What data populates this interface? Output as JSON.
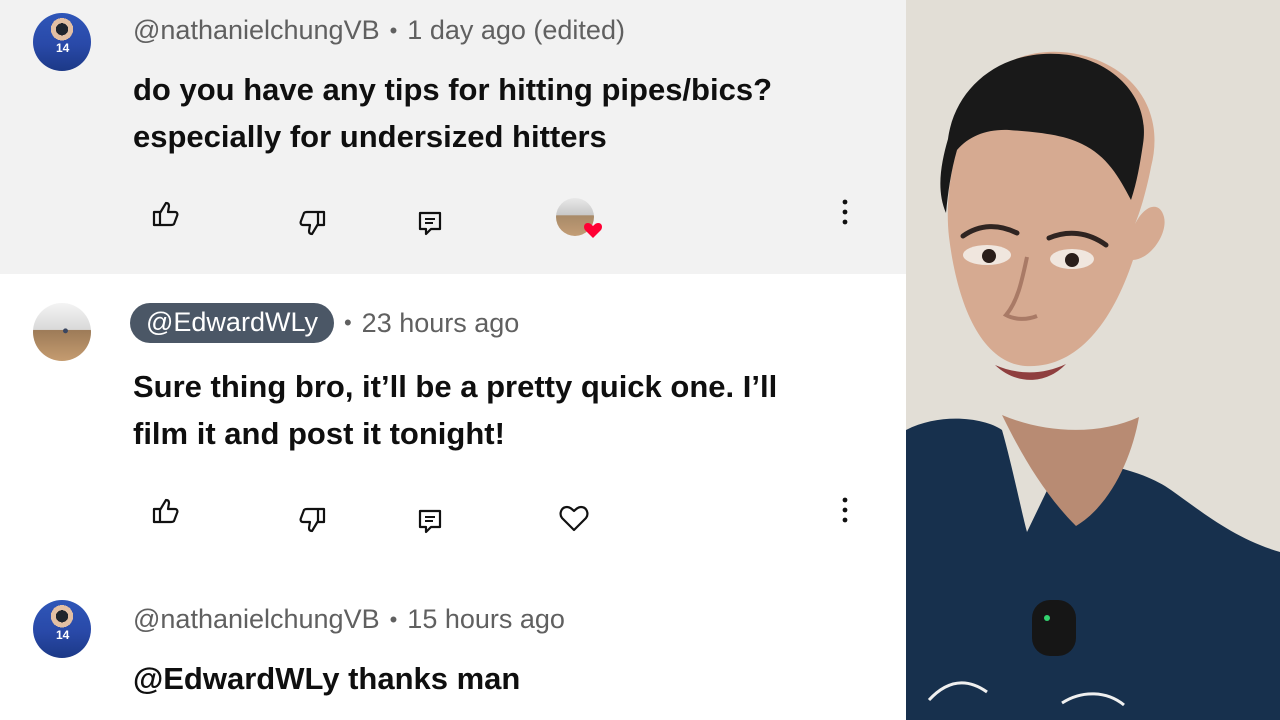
{
  "comments": [
    {
      "handle": "@nathanielchungVB",
      "separator": "•",
      "timestamp": "1 day ago (edited)",
      "text_lines": [
        "do you have any tips for hitting pipes/bics?",
        "especially for undersized hitters"
      ],
      "highlighted": true,
      "liked_by_creator": true
    },
    {
      "handle": "@EdwardWLy",
      "separator": "•",
      "timestamp": "23 hours ago",
      "text_lines": [
        "Sure thing bro, it’ll be a pretty quick one. I’ll",
        "film it and post it tonight!"
      ],
      "highlighted": false,
      "creator_badge": true
    },
    {
      "handle": "@nathanielchungVB",
      "separator": "•",
      "timestamp": "15 hours ago",
      "text_lines": [
        "@EdwardWLy thanks man"
      ],
      "highlighted": false
    }
  ],
  "icons": {
    "like": "thumb-up-icon",
    "dislike": "thumb-down-icon",
    "reply": "comment-reply-icon",
    "heart": "heart-icon",
    "more": "more-vertical-icon",
    "creator_heart": "creator-heart-icon"
  },
  "colors": {
    "highlight_background": "#f2f2f2",
    "creator_pill": "#4b5766",
    "heart_red": "#ff0033",
    "reaction_shirt": "#17304d"
  }
}
